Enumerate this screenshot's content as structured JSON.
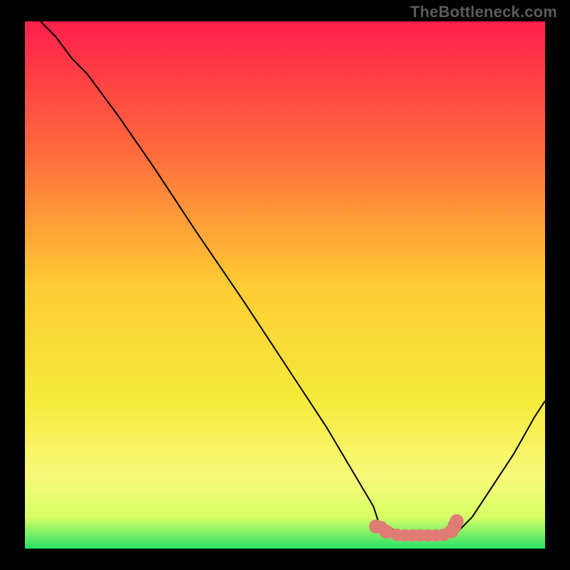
{
  "watermark": "TheBottleneck.com",
  "chart_data": {
    "type": "line",
    "title": "",
    "xlabel": "",
    "ylabel": "",
    "xlim": [
      0,
      100
    ],
    "ylim": [
      0,
      100
    ],
    "grid": false,
    "background_gradient": {
      "stops": [
        {
          "offset": 0,
          "color": "#ff1f4b"
        },
        {
          "offset": 25,
          "color": "#ff6b3d"
        },
        {
          "offset": 50,
          "color": "#ffcc33"
        },
        {
          "offset": 72,
          "color": "#f5eb3a"
        },
        {
          "offset": 86,
          "color": "#f9f97a"
        },
        {
          "offset": 94,
          "color": "#d8ff66"
        },
        {
          "offset": 100,
          "color": "#27e269"
        }
      ]
    },
    "series": [
      {
        "name": "bottleneck-curve",
        "color": "#000000",
        "width": 2,
        "x": [
          3,
          6,
          9,
          12,
          18,
          25,
          33,
          42,
          50,
          58,
          64,
          67,
          68,
          72,
          76,
          80,
          82,
          83,
          86,
          90,
          94,
          98,
          100
        ],
        "y": [
          100,
          97,
          93,
          90,
          82,
          72,
          60,
          47,
          35,
          23,
          13,
          8,
          5,
          3,
          2.4,
          2.4,
          2.4,
          3,
          6,
          12,
          18,
          25,
          28
        ]
      }
    ],
    "markers": {
      "name": "highlight-region",
      "color": "#e17c75",
      "shape": "rounded",
      "points": [
        {
          "x": 67.5,
          "y": 4.2,
          "r": 1.6
        },
        {
          "x": 68.5,
          "y": 4.0,
          "r": 1.4
        },
        {
          "x": 69.5,
          "y": 3.2,
          "r": 1.6
        },
        {
          "x": 71.5,
          "y": 2.6,
          "r": 1.3
        },
        {
          "x": 73.0,
          "y": 2.5,
          "r": 1.3
        },
        {
          "x": 74.5,
          "y": 2.5,
          "r": 1.3
        },
        {
          "x": 76.0,
          "y": 2.5,
          "r": 1.3
        },
        {
          "x": 77.5,
          "y": 2.5,
          "r": 1.3
        },
        {
          "x": 79.0,
          "y": 2.5,
          "r": 1.3
        },
        {
          "x": 80.5,
          "y": 2.6,
          "r": 1.3
        },
        {
          "x": 82.0,
          "y": 3.3,
          "r": 1.6
        },
        {
          "x": 82.6,
          "y": 4.3,
          "r": 1.6
        },
        {
          "x": 83.0,
          "y": 5.2,
          "r": 1.6
        }
      ]
    }
  }
}
